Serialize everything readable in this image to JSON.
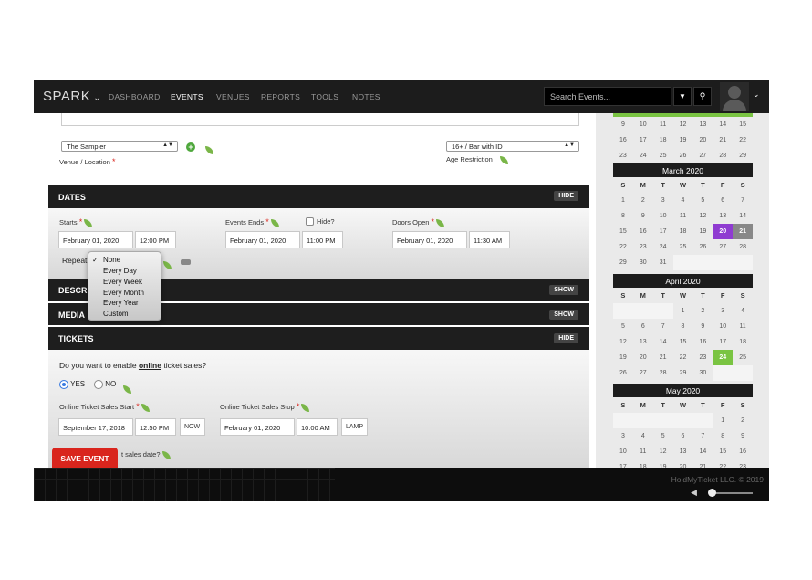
{
  "nav": {
    "brand": "SPARK",
    "items": [
      "DASHBOARD",
      "EVENTS",
      "VENUES",
      "REPORTS",
      "TOOLS",
      "NOTES"
    ],
    "active": "EVENTS",
    "search_placeholder": "Search Events..."
  },
  "venue": {
    "value": "The Sampler",
    "label": "Venue / Location",
    "age_value": "16+ / Bar with ID",
    "age_label": "Age Restriction"
  },
  "dates": {
    "title": "DATES",
    "toggle": "HIDE",
    "starts_label": "Starts",
    "starts_date": "February 01, 2020",
    "starts_time": "12:00 PM",
    "ends_label": "Events Ends",
    "hide_label": "Hide?",
    "ends_date": "February 01, 2020",
    "ends_time": "11:00 PM",
    "doors_label": "Doors Open",
    "doors_date": "February 01, 2020",
    "doors_time": "11:30 AM",
    "repeat_label": "Repeat",
    "repeat_options": [
      "None",
      "Every Day",
      "Every Week",
      "Every Month",
      "Every Year",
      "Custom"
    ],
    "repeat_selected": "None"
  },
  "description": {
    "title": "DESCR",
    "toggle": "SHOW"
  },
  "media": {
    "title": "MEDIA",
    "toggle": "SHOW"
  },
  "tickets": {
    "title": "TICKETS",
    "toggle": "HIDE",
    "question_pre": "Do you want to enable ",
    "question_link": "online",
    "question_post": " ticket sales?",
    "yes": "YES",
    "no": "NO",
    "start_label": "Online Ticket Sales Start",
    "start_date": "September 17, 2018",
    "start_time": "12:50 PM",
    "now_btn": "NOW",
    "stop_label": "Online Ticket Sales Stop",
    "stop_date": "February 01, 2020",
    "stop_time": "10:00 AM",
    "lamp_btn": "LAMP",
    "partial_text": "t sales date?"
  },
  "save_button": "SAVE EVENT",
  "footer": {
    "copyright": "HoldMyTicket LLC. © 2019"
  },
  "calendar": {
    "day_headers": [
      "S",
      "M",
      "T",
      "W",
      "T",
      "F",
      "S"
    ],
    "feb_rows": [
      [
        "9",
        "10",
        "11",
        "12",
        "13",
        "14",
        "15"
      ],
      [
        "16",
        "17",
        "18",
        "19",
        "20",
        "21",
        "22"
      ],
      [
        "23",
        "24",
        "25",
        "26",
        "27",
        "28",
        "29"
      ]
    ],
    "march_title": "March 2020",
    "march_rows": [
      [
        "1",
        "2",
        "3",
        "4",
        "5",
        "6",
        "7"
      ],
      [
        "8",
        "9",
        "10",
        "11",
        "12",
        "13",
        "14"
      ],
      [
        "15",
        "16",
        "17",
        "18",
        "19",
        "20",
        "21"
      ],
      [
        "22",
        "23",
        "24",
        "25",
        "26",
        "27",
        "28"
      ],
      [
        "29",
        "30",
        "31",
        "",
        "",
        "",
        ""
      ]
    ],
    "april_title": "April 2020",
    "april_rows": [
      [
        "",
        "",
        "",
        "1",
        "2",
        "3",
        "4"
      ],
      [
        "5",
        "6",
        "7",
        "8",
        "9",
        "10",
        "11"
      ],
      [
        "12",
        "13",
        "14",
        "15",
        "16",
        "17",
        "18"
      ],
      [
        "19",
        "20",
        "21",
        "22",
        "23",
        "24",
        "25"
      ],
      [
        "26",
        "27",
        "28",
        "29",
        "30",
        "",
        ""
      ]
    ],
    "may_title": "May 2020",
    "may_rows": [
      [
        "",
        "",
        "",
        "",
        "",
        "1",
        "2"
      ],
      [
        "3",
        "4",
        "5",
        "6",
        "7",
        "8",
        "9"
      ],
      [
        "10",
        "11",
        "12",
        "13",
        "14",
        "15",
        "16"
      ],
      [
        "17",
        "18",
        "19",
        "20",
        "21",
        "22",
        "23"
      ]
    ],
    "today": "20",
    "selected": "21",
    "highlight_april": "24"
  },
  "colors": {
    "accent": "#7ac442",
    "today": "#8f3bd1",
    "save": "#d9251d"
  }
}
